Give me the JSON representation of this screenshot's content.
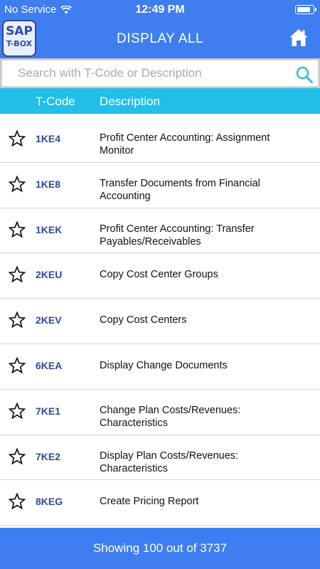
{
  "status_bar": {
    "carrier": "No Service",
    "time": "12:49 PM",
    "battery_level": 0.9,
    "icons": [
      "wifi-icon",
      "battery-icon"
    ]
  },
  "nav": {
    "logo_top": "SAP",
    "logo_bottom": "T-BOX",
    "title": "DISPLAY ALL",
    "home_icon": "home-icon"
  },
  "search": {
    "placeholder": "Search with T-Code or Description",
    "value": "",
    "icon": "search-icon"
  },
  "columns": {
    "tcode": "T-Code",
    "description": "Description"
  },
  "rows": [
    {
      "tcode": "1KE4",
      "description": "Profit Center Accounting: Assignment Monitor",
      "lines": 2
    },
    {
      "tcode": "1KE8",
      "description": "Transfer Documents from Financial Accounting",
      "lines": 2
    },
    {
      "tcode": "1KEK",
      "description": "Profit Center Accounting: Transfer Payables/Receivables",
      "lines": 2
    },
    {
      "tcode": "2KEU",
      "description": "Copy Cost Center Groups",
      "lines": 1
    },
    {
      "tcode": "2KEV",
      "description": "Copy Cost Centers",
      "lines": 1
    },
    {
      "tcode": "6KEA",
      "description": "Display Change Documents",
      "lines": 1
    },
    {
      "tcode": "7KE1",
      "description": "Change Plan Costs/Revenues: Characteristics",
      "lines": 2
    },
    {
      "tcode": "7KE2",
      "description": "Display Plan Costs/Revenues: Characteristics",
      "lines": 2
    },
    {
      "tcode": "8KEG",
      "description": "Create Pricing Report",
      "lines": 1
    }
  ],
  "footer": {
    "text": "Showing 100 out of 3737"
  },
  "colors": {
    "primary": "#3f7ef0",
    "header": "#22bfe8",
    "tcode": "#2e4a9a"
  }
}
